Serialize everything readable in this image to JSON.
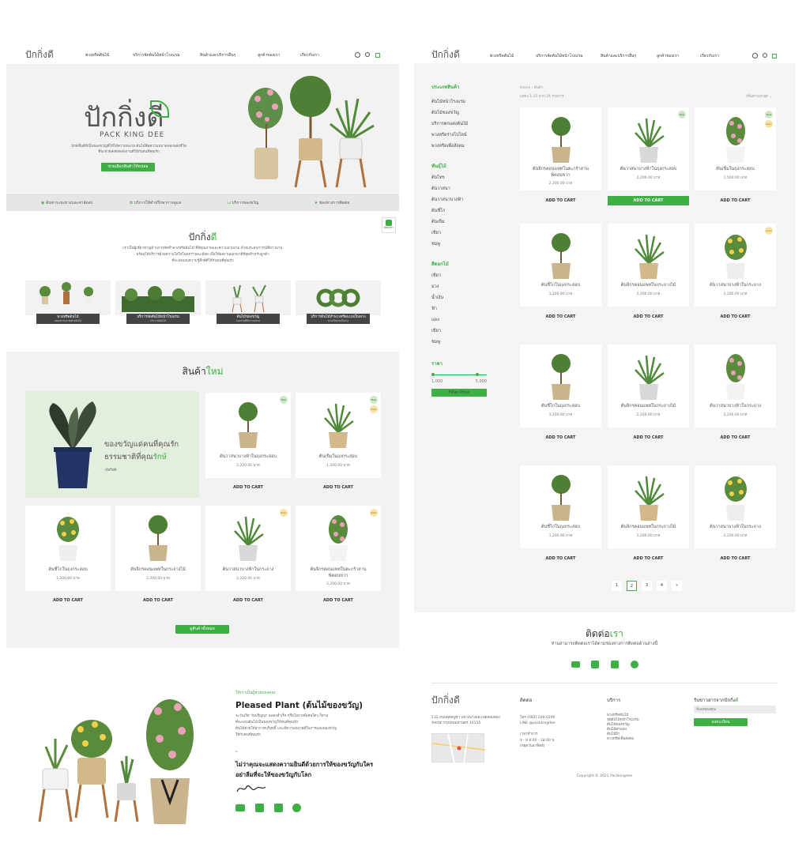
{
  "brand": {
    "logo": "ปักกิ่งดี",
    "sub": "PACKKINGDEE"
  },
  "nav": [
    "พวงหรีดต้นไม้",
    "บริการจัดต้นไม้หน้าโรงแรม",
    "สินค้าและบริการอื่นๆ",
    "ลูกค้าของเรา",
    "เกี่ยวกับเรา"
  ],
  "hero": {
    "title": "ปักกิ่งดี",
    "sub": "PACK KING DEE",
    "desc1": "ปักษ์ชั้นดีที่เป็นของขวัญที่ให้ได้ความหมาย ต้นไม้คือความหมายของพลังชีวิต",
    "desc2": "ที่จะช่วยส่งต่อพลังงานดีให้กับคนที่คุณรัก",
    "button": "ช่วยเลือกสินค้าให้หน่อย"
  },
  "features": [
    "ค้นหาระยะทางและค่าจัดส่ง",
    "บริการให้คำปรึกษาการดูแล",
    "บริการของขวัญ",
    "ช่องทางการติดต่อ"
  ],
  "about": {
    "title_main": "ปักกิ่ง",
    "title_accent": "ดี",
    "p1": "เราเป็นผู้เชี่ยวชาญด้านการจัดทำพวงหรีดต้นไม้ ที่มีคุณภาพและความสวยงาม ด้วยประสบการณ์ที่ยาวนาน",
    "p2": "พร้อมให้บริการด้วยความใส่ใจในทุกรายละเอียด เพื่อให้ผลงานออกมาดีที่สุดสำหรับลูกค้า",
    "p3": "ที่จะส่งมอบความรู้สึกดีดีให้กับคนที่คุณรัก"
  },
  "categories": [
    {
      "label": "พวงหรีดต้นไม้",
      "sub": "แสดงความอาลัยด้วยต้นไม้"
    },
    {
      "label": "บริการจัดต้นไม้หน้าโรงแรม",
      "sub": "บริการจัดต้นไม้"
    },
    {
      "label": "ต้นไม้ของขวัญ",
      "sub": "ของขวัญที่มีความหมาย"
    },
    {
      "label": "บริการต้นไม้ทำพวงหรีดแบบเป็นหวง",
      "sub": "พวงหรีดแบบเป็นหวง"
    }
  ],
  "line_badge": "ติดต่อเรา",
  "new_products": {
    "title_main": "สินค้า",
    "title_accent": "ใหม่",
    "promo_line1": "ของขวัญแด่คนที่คุณรัก",
    "promo_line2": "ธรรมชาติที่คุณ",
    "promo_accent": "รักษ์",
    "promo_sign": "-ปักกิ่งดี-",
    "more_button": "ดูสินค้าทั้งหมด"
  },
  "home_products": [
    {
      "name": "ต้นวาสนาบางฟ้าในถุงกระสอบ",
      "price": "2,200.00 บาท",
      "badge": "New"
    },
    {
      "name": "ต้นเข็มในถุงกระสอบ",
      "price": "1,500.00 บาท",
      "badge": "New",
      "badge2": "Sale!"
    },
    {
      "name": "ต้นชี่โกในถุงกระสอบ",
      "price": "1,200.00 บาท"
    },
    {
      "name": "ต้นจิกรคอนแพทในกระถางไม้",
      "price": "2,200.00 บาท"
    },
    {
      "name": "ต้นวาสนาบางฟ้าในกระถาง",
      "price": "2,200.00 บาท",
      "badge2": "Sale!"
    },
    {
      "name": "ต้นจิกรคอนแพทในตะกร้าสาน",
      "name2": "พิคอนขวา",
      "price": "2,200.00 บาท",
      "badge2": "Sale!"
    }
  ],
  "add_to_cart": "ADD TO CART",
  "shop": {
    "breadcrumb": "Home › สินค้า",
    "result": "แสดง 1-12 จาก 24 รายการ",
    "sort": "เรียงตามล่าสุด",
    "cat_title": "ประเภทสินค้า",
    "cat_items": [
      "ต้นไม้หน้าโรงแรม",
      "ต้นไม้ของขวัญ",
      "บริการตกแต่งต้นไม้",
      "พวงหรีดร่างโบไลน์",
      "พวงหรีดเพื่อสังคม"
    ],
    "plant_title": "พันธุ์ไม้",
    "plant_items": [
      "ต้นไทร",
      "ต้นวาสนา",
      "ต้นวาสนาบางฟ้า",
      "ต้นชี่โก",
      "ต้นเข็ม",
      "เขียว",
      "ชมพู"
    ],
    "color_title": "สีดอกไม้",
    "color_items": [
      "เขียว",
      "ม่วง",
      "น้ำเงิน",
      "ฟ้า",
      "แดง",
      "เขียว",
      "ชมพู"
    ],
    "price_title": "ราคา",
    "price_min": "1,000",
    "price_max": "5,000",
    "filter_button": "Filter Price",
    "pages": [
      "1",
      "2",
      "3",
      "4",
      "»"
    ]
  },
  "shop_products": [
    {
      "name": "ต้นจิกรคอนแพทในตะกร้าสาน",
      "name2": "พิคอนขวา",
      "price": "2,200.00 บาท"
    },
    {
      "name": "ต้นวาสนาบางฟ้าในถุงกระสอบ",
      "price": "2,200.00 บาท",
      "badge": "New",
      "highlight": true
    },
    {
      "name": "ต้นเข็มในถุงกระสอบ",
      "price": "1,500.00 บาท",
      "badge": "New",
      "badge2": "Sale!"
    },
    {
      "name": "ต้นชี่โกในถุงกระสอบ",
      "price": "1,200.00 บาท"
    },
    {
      "name": "ต้นจิกรคอนแพทในกระถางไม้",
      "price": "2,200.00 บาท"
    },
    {
      "name": "ต้นวาสนาบางฟ้าในกระถาง",
      "price": "2,200.00 บาท",
      "badge2": "Sale!"
    },
    {
      "name": "ต้นชี่โกในถุงกระสอบ",
      "price": "1,200.00 บาท"
    },
    {
      "name": "ต้นจิกรคอนแพทในกระถางไม้",
      "price": "2,200.00 บาท"
    },
    {
      "name": "ต้นวาสนาบางฟ้าในกระถาง",
      "price": "2,200.00 บาท"
    },
    {
      "name": "ต้นชี่โกในถุงกระสอบ",
      "price": "1,200.00 บาท"
    },
    {
      "name": "ต้นจิกรคอนแพทในกระถางไม้",
      "price": "2,200.00 บาท"
    },
    {
      "name": "ต้นวาสนาบางฟ้าในกระถาง",
      "price": "2,200.00 บาท"
    }
  ],
  "contact": {
    "title_main": "ติดต่อ",
    "title_accent": "เรา",
    "sub": "ท่านสามารถติดต่อเราได้ตามช่องทางการติดต่อด้านล่างนี้"
  },
  "footer": {
    "address1": "132 ถนนพุทธบูชา แขวงบางมด เขตจอมทอง",
    "address2": "จังหวัด กรุงเทพมหานคร 10150",
    "contact_title": "ติดต่อ",
    "phone": "โทร (082) 246-0296",
    "line": "LINE @packkingdee",
    "hours_title": "เวลาทำการ",
    "hours": "จ - ส 8:00 - 18:00 น",
    "hours_note": "(หยุดวันอาทิตย์)",
    "service_title": "บริการ",
    "services": [
      "พวงหรีดต้นไม้",
      "จัดต้นไม้หน้าโรงแรม",
      "ต้นไม้ของขวัญ",
      "ต้นไม้ตกแต่ง",
      "ต้นไม้ฝ้า",
      "พวงหรีดเพื่อสังคม"
    ],
    "news_title": "รับข่าวสารจากปักกิ่ง",
    "news_accent": "ดี",
    "news_placeholder": "อีเมลของคุณ",
    "news_button": "ลงทะเบียน",
    "copyright": "Copyright © 2021 Packkingdee"
  },
  "pleased": {
    "kicker": "ให้เราเป็นผู้ช่วยของคุณ",
    "title": "Pleased Plant (ต้นไม้ของขวัญ)",
    "p1": "จะวันเกิด วันปริญญา ฉลองสำเร็จ หรือโอกาสพิเศษใดๆ ก็ตาม",
    "p2": "ที่จะมอบต้นไม้เป็นของขวัญให้คนที่คุณรัก",
    "p3": "ต้นไม้ช่วยให้อากาศบริสุทธิ์ และมีความหมายดีในการมอบของขวัญ",
    "p4": "ให้กับคนที่คุณรัก",
    "quote1": "ไม่ว่าคุณจะแสดงความยินดีด้วยการให้ของขวัญกับใคร",
    "quote2": "อย่าลืมที่จะให้ของขวัญกับโลก"
  },
  "colors": {
    "accent": "#3cb043",
    "panel": "#f2f2f2",
    "promo": "#e4eedf"
  }
}
